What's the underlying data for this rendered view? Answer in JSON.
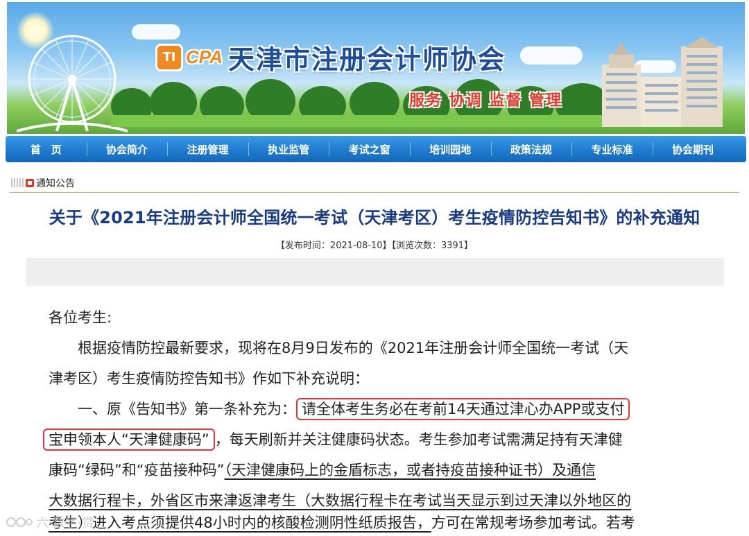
{
  "header": {
    "logo_mark": "TI",
    "logo_cpa": "CPA",
    "site_title": "天津市注册会计师协会",
    "slogan": "服务 协调 监督 管理"
  },
  "nav": {
    "items": [
      "首　页",
      "协会简介",
      "注册管理",
      "执业监管",
      "考试之窗",
      "培训园地",
      "政策法规",
      "专业标准",
      "协会期刊"
    ]
  },
  "section": {
    "title": "通知公告"
  },
  "article": {
    "title": "关于《2021年注册会计师全国统一考试（天津考区）考生疫情防控告知书》的补充通知",
    "meta": "【发布时间：2021-08-10】【浏览次数：3391】",
    "greeting": "各位考生:",
    "para1_l1": "根据疫情防控最新要求，现将在8月9日发布的《2021年注册会计师全国统一考试（天",
    "para1_l2": "津考区）考生疫情防控告知书》作如下补充说明：",
    "para2_l1_a": "一、原《告知书》第一条补充为：",
    "para2_l1_hl": "请全体考生务必在考前14天通过津心办APP或支付",
    "para2_l2_hl": "宝申领本人“天津健康码”",
    "para2_l2_b": "，每天刷新并关注健康码状态。考生参加考试需满足持有天津健",
    "para2_l3_a": "康码“绿码”和“疫苗接种码”",
    "para2_l3_u": "（天津健康码上的金盾标志，或者持疫苗接种证书）及通信",
    "para2_l4_u": "大数据行程卡，外省区市来津返津考生（大数据行程卡在考试当天显示到过天津以外地区的",
    "para2_l5_u": "考生）进入考点须提供48小时内的核酸检测阴性纸质报告，",
    "para2_l5_b": "方可在常规考场参加考试。若考"
  },
  "watermark": {
    "text": "六·数字·赏"
  },
  "colors": {
    "nav_blue": "#1f7bcf",
    "title_blue": "#173a82",
    "highlight_red": "#e0383a",
    "divider_orange": "#e3a257"
  }
}
